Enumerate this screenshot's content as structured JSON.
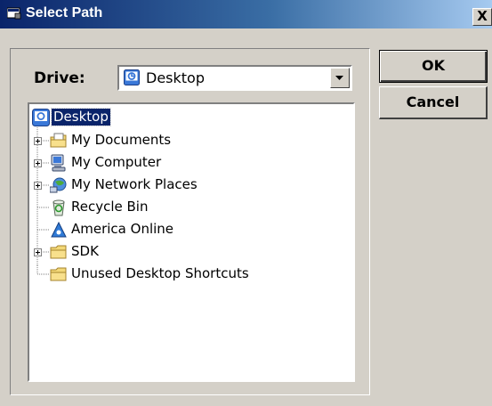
{
  "window": {
    "title": "Select Path",
    "close_glyph": "X"
  },
  "drive": {
    "label": "Drive:",
    "selected": "Desktop",
    "icon": "desktop-icon"
  },
  "tree": {
    "root": {
      "label": "Desktop",
      "icon": "desktop-icon",
      "selected": true
    },
    "items": [
      {
        "label": "My Documents",
        "icon": "documents-folder-icon",
        "expandable": true
      },
      {
        "label": "My Computer",
        "icon": "computer-icon",
        "expandable": true
      },
      {
        "label": "My Network Places",
        "icon": "network-places-icon",
        "expandable": true
      },
      {
        "label": "Recycle Bin",
        "icon": "recycle-bin-icon",
        "expandable": false
      },
      {
        "label": "America Online",
        "icon": "aol-icon",
        "expandable": false
      },
      {
        "label": "SDK",
        "icon": "folder-icon",
        "expandable": true
      },
      {
        "label": "Unused Desktop Shortcuts",
        "icon": "folder-icon",
        "expandable": false
      }
    ]
  },
  "buttons": {
    "ok": "OK",
    "cancel": "Cancel"
  },
  "colors": {
    "titlebar_start": "#0a246a",
    "titlebar_end": "#a6caf0",
    "dialog_face": "#d4d0c8",
    "selection": "#0a246a"
  }
}
